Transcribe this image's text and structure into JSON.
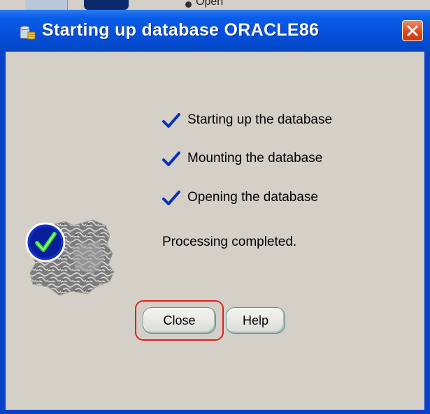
{
  "background": {
    "partial_text": "Open"
  },
  "dialog": {
    "title": "Starting up database ORACLE86",
    "title_icon": "database-wizard-icon",
    "close_icon": "close-icon",
    "steps": [
      {
        "label": "Starting up the database",
        "icon": "checkmark-icon",
        "done": true
      },
      {
        "label": "Mounting the database",
        "icon": "checkmark-icon",
        "done": true
      },
      {
        "label": "Opening the database",
        "icon": "checkmark-icon",
        "done": true
      }
    ],
    "status": "Processing completed.",
    "illustration": "success-check-icon",
    "buttons": {
      "close": "Close",
      "help": "Help"
    }
  },
  "colors": {
    "titlebar": "#0550dc",
    "client_bg": "#d4d0c8",
    "check": "#0b2fb8",
    "focus_ring": "#e02020"
  }
}
